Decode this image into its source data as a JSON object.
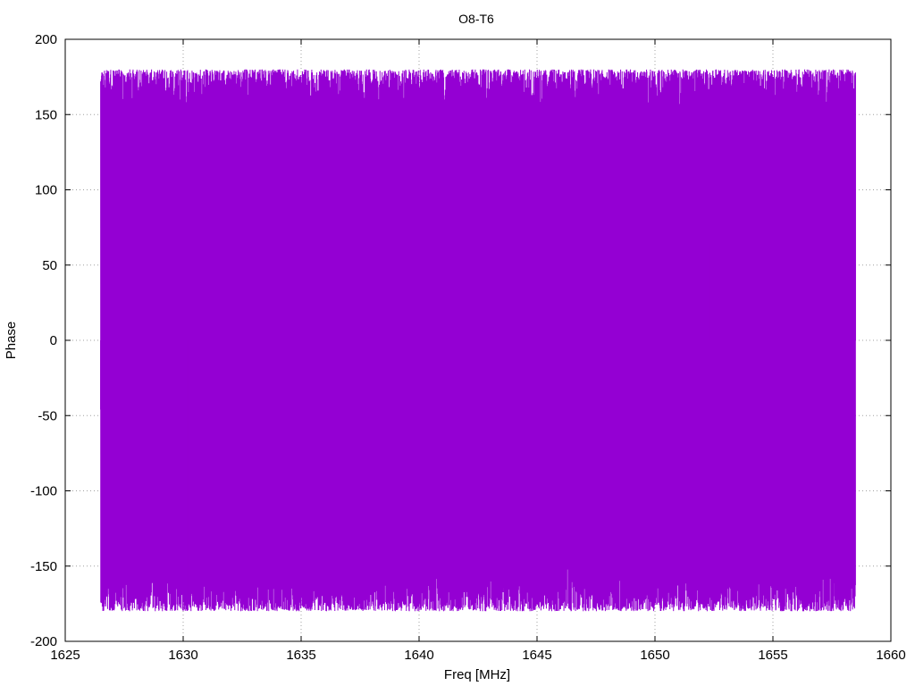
{
  "chart_data": {
    "type": "line",
    "title": "O8-T6",
    "xlabel": "Freq [MHz]",
    "ylabel": "Phase",
    "xlim": [
      1625,
      1660
    ],
    "ylim": [
      -200,
      200
    ],
    "xticks": [
      1625,
      1630,
      1635,
      1640,
      1645,
      1650,
      1655,
      1660
    ],
    "yticks": [
      200,
      150,
      100,
      50,
      0,
      -50,
      -100,
      -150,
      -200
    ],
    "grid": true,
    "series": [
      {
        "color": "#9400d3",
        "x_start": 1626.5,
        "x_end": 1658.5,
        "y_min": -180,
        "y_max": 180,
        "note_of_shape": "phase wraps rapidly between about -180 and 180 across the whole band",
        "x": [
          1626.5,
          1626.6,
          1627.4,
          1628.9,
          1630.2,
          1631.1,
          1632.3,
          1633.5,
          1634.8,
          1636.1,
          1637.5,
          1638.3,
          1639.9,
          1641.2,
          1642.5,
          1643.6,
          1644.9,
          1646.2,
          1647.4,
          1648.6,
          1649.8,
          1651.0,
          1652.3,
          1653.6,
          1654.9,
          1656.3,
          1657.6,
          1658.5
        ],
        "y": [
          -46,
          165,
          -178,
          172,
          -170,
          176,
          -175,
          168,
          -180,
          174,
          56,
          -178,
          170,
          -176,
          75,
          -175,
          172,
          -178,
          168,
          -30,
          177,
          -176,
          64,
          -178,
          175,
          -180,
          -170,
          178
        ]
      }
    ]
  }
}
